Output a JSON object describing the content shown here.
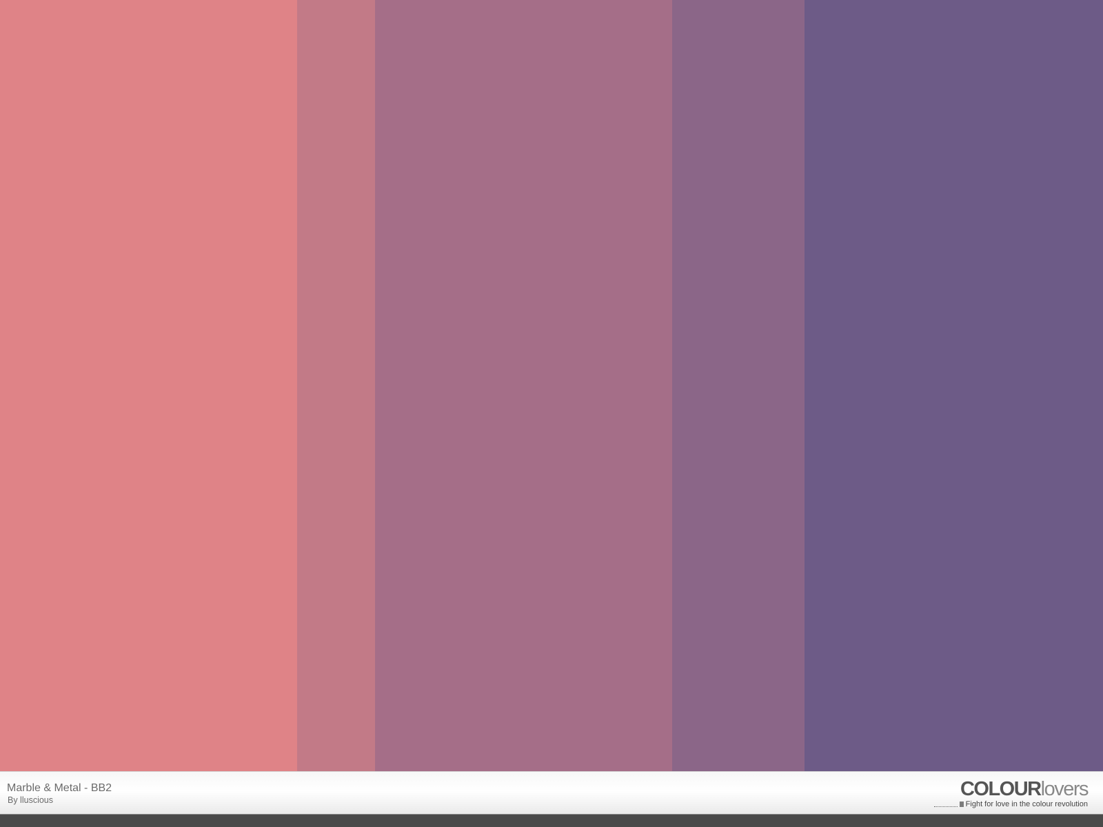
{
  "palette": {
    "title": "Marble & Metal - BB2",
    "author": "By lluscious",
    "swatches": [
      {
        "color": "#df8387",
        "share": 0.2694
      },
      {
        "color": "#c27a87",
        "share": 0.0706
      },
      {
        "color": "#a56e88",
        "share": 0.2694
      },
      {
        "color": "#8b6688",
        "share": 0.12
      },
      {
        "color": "#6d5b87",
        "share": 0.2706
      }
    ]
  },
  "brand": {
    "name_bold": "COLOUR",
    "name_light": "lovers",
    "tagline": "Fight for love in the colour revolution"
  }
}
